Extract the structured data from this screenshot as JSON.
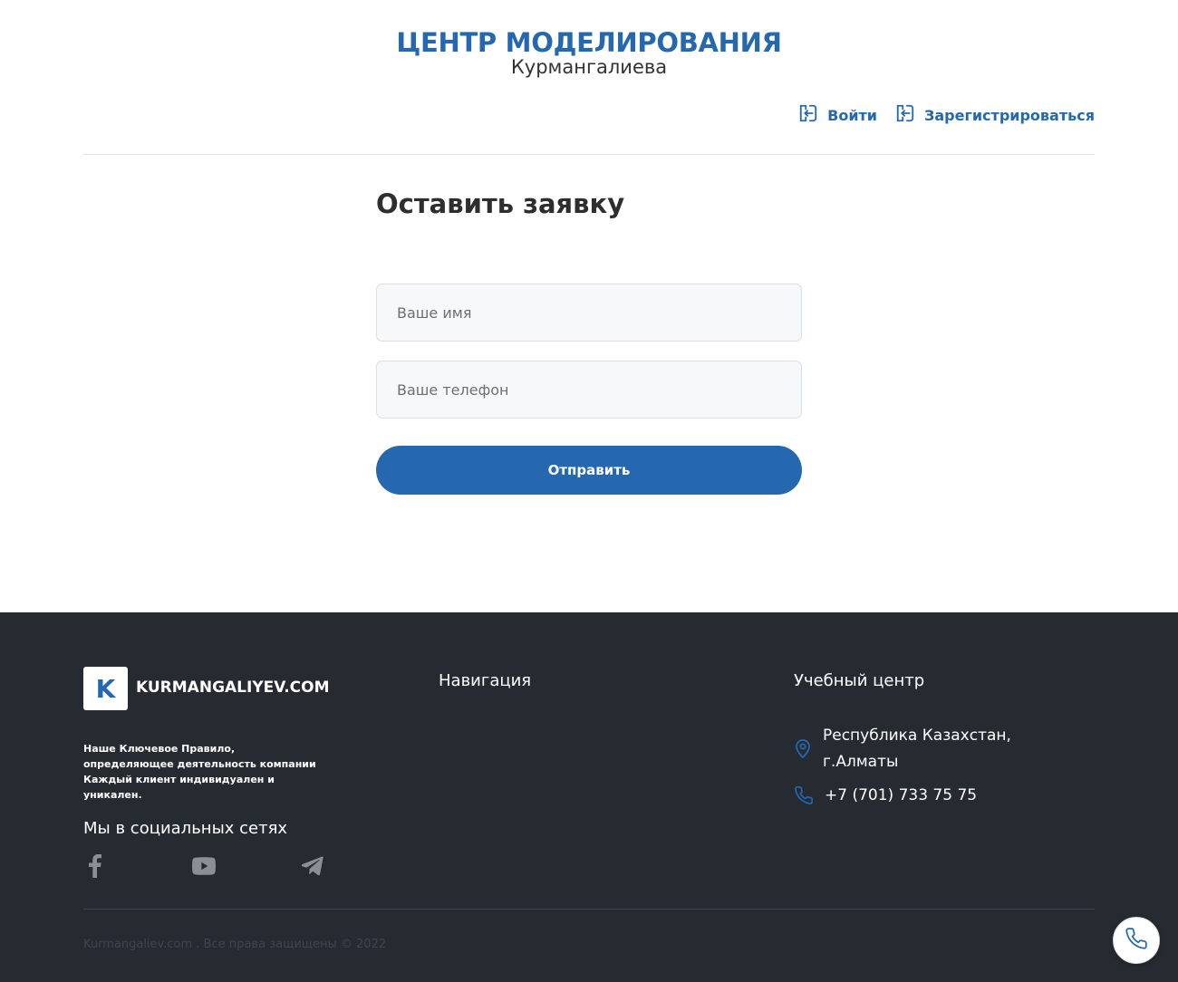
{
  "header": {
    "brand_title": "ЦЕНТР МОДЕЛИРОВАНИЯ",
    "brand_subtitle": "Курмангалиева",
    "login_label": "Войти",
    "register_label": "Зарегистрироваться",
    "login_icon": "sign-in-icon",
    "register_icon": "sign-in-icon"
  },
  "form": {
    "title": "Оставить заявку",
    "name_placeholder": "Ваше имя",
    "name_value": "",
    "phone_placeholder": "Ваше телефон",
    "phone_value": "",
    "submit_label": "Отправить"
  },
  "footer": {
    "logo_letter": "K",
    "logo_text": "KURMANGALIYEV.COM",
    "about": "Наше Ключевое Правило, определяющее деятельность компании Каждый клиент индивидуален и уникален.",
    "social_title": "Мы в социальных сетях",
    "socials": [
      "facebook-icon",
      "youtube-icon",
      "telegram-icon"
    ],
    "nav_title": "Навигация",
    "center_title": "Учебный центр",
    "address_line1": "Республика Казахстан,",
    "address_line2": "г.Алматы",
    "phone": "+7 (701) 733 75 75",
    "copyright": "Kurmangaliev.com . Все права защищены © 2022"
  },
  "colors": {
    "accent": "#2568b0",
    "footer_bg": "#262b32",
    "page_bg": "#ffffff"
  },
  "fab": {
    "icon": "phone-icon"
  }
}
